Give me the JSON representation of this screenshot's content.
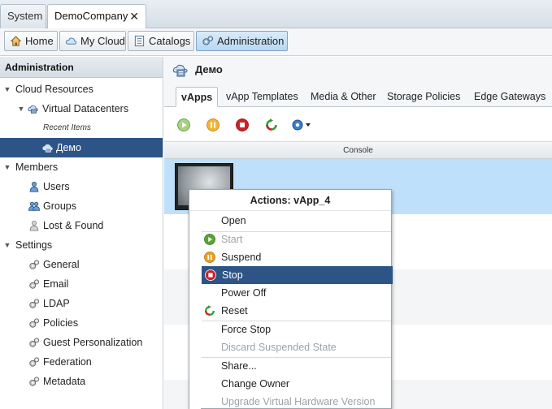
{
  "top_tabs": {
    "system": "System",
    "company": "DemoCompany",
    "close_glyph": "✕"
  },
  "nav": {
    "home": "Home",
    "my_cloud": "My Cloud",
    "catalogs": "Catalogs",
    "administration": "Administration"
  },
  "sidebar": {
    "header": "Administration",
    "cloud_resources": "Cloud Resources",
    "virtual_datacenters": "Virtual Datacenters",
    "recent_items": "Recent Items",
    "demo": "Демо",
    "members": "Members",
    "users": "Users",
    "groups": "Groups",
    "lost_found": "Lost & Found",
    "settings": "Settings",
    "general": "General",
    "email": "Email",
    "ldap": "LDAP",
    "policies": "Policies",
    "guest_personalization": "Guest Personalization",
    "federation": "Federation",
    "metadata": "Metadata"
  },
  "main": {
    "title": "Демо",
    "tabs": [
      "vApps",
      "vApp Templates",
      "Media & Other",
      "Storage Policies",
      "Edge Gateways"
    ],
    "column_console": "Console"
  },
  "context_menu": {
    "title": "Actions: vApp_4",
    "open": "Open",
    "start": "Start",
    "suspend": "Suspend",
    "stop": "Stop",
    "power_off": "Power Off",
    "reset": "Reset",
    "force_stop": "Force Stop",
    "discard_suspended": "Discard Suspended State",
    "share": "Share...",
    "change_owner": "Change Owner",
    "upgrade_hw": "Upgrade Virtual Hardware Version"
  },
  "colors": {
    "selection": "#2c5486",
    "row_selected": "#bfe0fb",
    "start_green": "#5aa33a",
    "suspend_orange": "#e8a020",
    "stop_red": "#d0202a",
    "reset_green": "#3a9a3a"
  }
}
